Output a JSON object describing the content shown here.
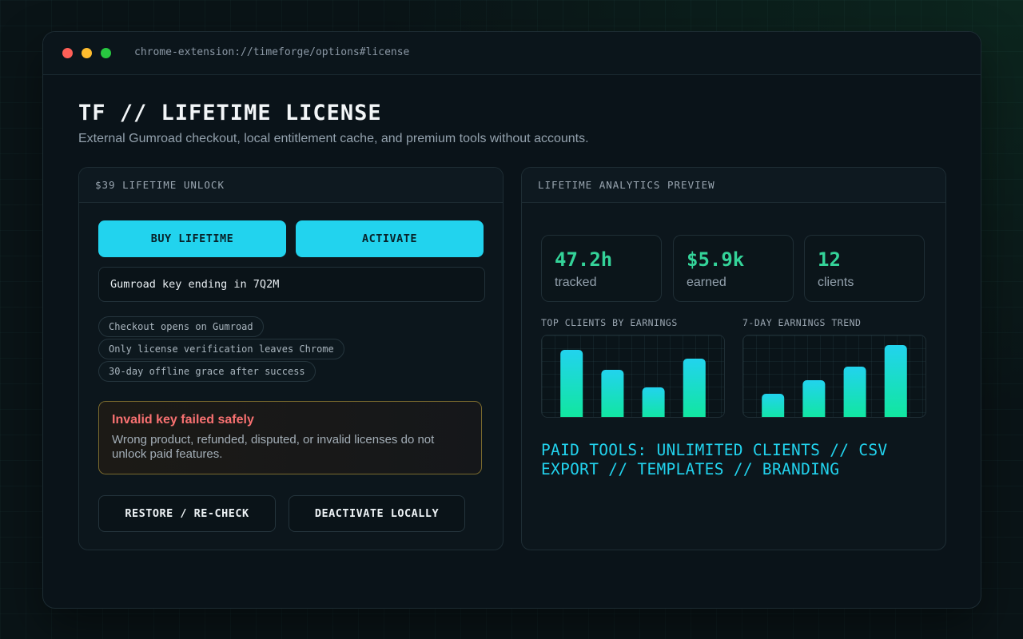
{
  "browser": {
    "url": "chrome-extension://timeforge/options#license"
  },
  "page": {
    "title": "TF // LIFETIME LICENSE",
    "subtitle": "External Gumroad checkout, local entitlement cache, and premium tools without accounts."
  },
  "license_panel": {
    "header": "$39 LIFETIME UNLOCK",
    "buy_label": "BUY LIFETIME",
    "activate_label": "ACTIVATE",
    "key_value": "Gumroad key ending in 7Q2M",
    "chips": [
      "Checkout opens on Gumroad",
      "Only license verification leaves Chrome",
      "30-day offline grace after success"
    ],
    "alert_title": "Invalid key failed safely",
    "alert_text": "Wrong product, refunded, disputed, or invalid licenses do not unlock paid features.",
    "restore_label": "RESTORE / RE-CHECK",
    "deactivate_label": "DEACTIVATE LOCALLY"
  },
  "analytics_panel": {
    "header": "LIFETIME ANALYTICS PREVIEW",
    "stats": [
      {
        "value": "47.2h",
        "label": "tracked"
      },
      {
        "value": "$5.9k",
        "label": "earned"
      },
      {
        "value": "12",
        "label": "clients"
      }
    ],
    "top_clients_title": "TOP CLIENTS BY EARNINGS",
    "trend_title": "7-DAY EARNINGS TREND",
    "paid_tools": "PAID TOOLS: UNLIMITED CLIENTS // CSV EXPORT // TEMPLATES // BRANDING"
  },
  "colors": {
    "accent": "#22d3ee",
    "stat_green": "#34d399",
    "alert_red": "#f87171",
    "bar_top": "#22d3ee",
    "bar_bottom": "#10e89a"
  },
  "chart_data": [
    {
      "type": "bar",
      "title": "TOP CLIENTS BY EARNINGS",
      "categories": [
        "",
        "",
        "",
        ""
      ],
      "values": [
        84,
        59,
        37,
        73
      ],
      "ylim": [
        0,
        100
      ]
    },
    {
      "type": "bar",
      "title": "7-DAY EARNINGS TREND",
      "categories": [
        "",
        "",
        "",
        ""
      ],
      "values": [
        29,
        46,
        63,
        90
      ],
      "ylim": [
        0,
        100
      ]
    }
  ]
}
